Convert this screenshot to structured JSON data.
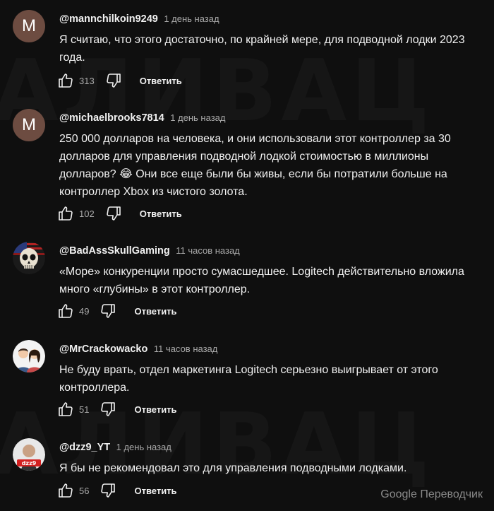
{
  "comments": [
    {
      "author": "@mannchilkoin9249",
      "time": "1 день назад",
      "text": "Я считаю, что этого достаточно, по крайней мере, для подводной лодки 2023 года.",
      "likes": "313",
      "reply_label": "Ответить",
      "avatar_letter": "M"
    },
    {
      "author": "@michaelbrooks7814",
      "time": "1 день назад",
      "text": "250 000 долларов на человека, и они использовали этот контроллер за 30 долларов для управления подводной лодкой стоимостью в миллионы долларов? 😂 Они все еще были бы живы, если бы потратили больше на контроллер Xbox из чистого золота.",
      "likes": "102",
      "reply_label": "Ответить",
      "avatar_letter": "M"
    },
    {
      "author": "@BadAssSkullGaming",
      "time": "11 часов назад",
      "text": "«Море» конкуренции просто сумасшедшее. Logitech действительно вложила много «глубины» в этот контроллер.",
      "likes": "49",
      "reply_label": "Ответить"
    },
    {
      "author": "@MrCrackowacko",
      "time": "11 часов назад",
      "text": "Не буду врать, отдел маркетинга Logitech серьезно выигрывает от этого контроллера.",
      "likes": "51",
      "reply_label": "Ответить"
    },
    {
      "author": "@dzz9_YT",
      "time": "1 день назад",
      "text": "Я бы не рекомендовал это для управления подводными лодками.",
      "likes": "56",
      "reply_label": "Ответить",
      "avatar_badge": "dzz9"
    }
  ],
  "translator_label": "Google Переводчик",
  "colors": {
    "background": "#0f0f0f",
    "text": "#f1f1f1",
    "secondary": "#aaaaaa",
    "letter_avatar": "#6d4c41"
  }
}
